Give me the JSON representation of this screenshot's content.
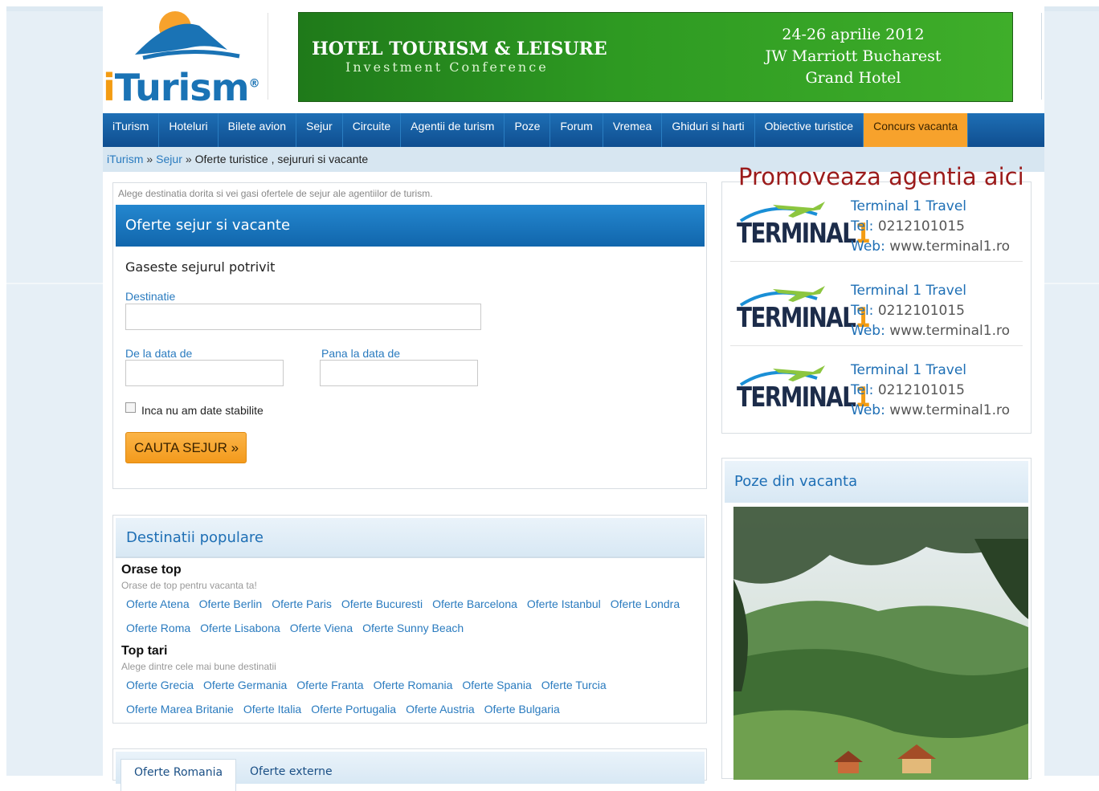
{
  "brand": {
    "logo_text_i": "i",
    "logo_text_rest": "Turism",
    "registered": "®"
  },
  "banner": {
    "title": "HOTEL TOURISM & LEISURE",
    "subtitle": "Investment Conference",
    "date": "24-26 aprilie 2012",
    "venue_line1": "JW Marriott Bucharest",
    "venue_line2": "Grand Hotel"
  },
  "nav": {
    "items": [
      {
        "label": "iTurism"
      },
      {
        "label": "Hoteluri"
      },
      {
        "label": "Bilete avion"
      },
      {
        "label": "Sejur"
      },
      {
        "label": "Circuite"
      },
      {
        "label": "Agentii de turism"
      },
      {
        "label": "Poze"
      },
      {
        "label": "Forum"
      },
      {
        "label": "Vremea"
      },
      {
        "label": "Ghiduri si harti"
      },
      {
        "label": "Obiective turistice"
      },
      {
        "label": "Concurs vacanta"
      }
    ],
    "active_color": "#f7a22c"
  },
  "breadcrumb": {
    "home": "iTurism",
    "sep": "»",
    "section": "Sejur",
    "current": "Oferte turistice , sejururi si vacante"
  },
  "search": {
    "hint": "Alege destinatia dorita si vei gasi ofertele de sejur ale agentiilor de turism.",
    "header": "Oferte sejur si vacante",
    "title": "Gaseste sejurul potrivit",
    "destination_label": "Destinatie",
    "destination_value": "",
    "from_label": "De la data de",
    "from_value": "",
    "to_label": "Pana la data de",
    "to_value": "",
    "no_dates_label": "Inca nu am date stabilite",
    "button": "CAUTA SEJUR »"
  },
  "destinations": {
    "header": "Destinatii populare",
    "cities_title": "Orase top",
    "cities_sub": "Orase de top pentru vacanta ta!",
    "cities_row1": [
      "Oferte Atena",
      "Oferte Berlin",
      "Oferte Paris",
      "Oferte Bucuresti",
      "Oferte Barcelona",
      "Oferte Istanbul",
      "Oferte Londra"
    ],
    "cities_row2": [
      "Oferte Roma",
      "Oferte Lisabona",
      "Oferte Viena",
      "Oferte Sunny Beach"
    ],
    "countries_title": "Top tari",
    "countries_sub": "Alege dintre cele mai bune destinatii",
    "countries_row1": [
      "Oferte Grecia",
      "Oferte Germania",
      "Oferte Franta",
      "Oferte Romania",
      "Oferte Spania",
      "Oferte Turcia"
    ],
    "countries_row2": [
      "Oferte Marea Britanie",
      "Oferte Italia",
      "Oferte Portugalia",
      "Oferte Austria",
      "Oferte Bulgaria"
    ]
  },
  "tabs": {
    "items": [
      "Oferte Romania",
      "Oferte externe"
    ]
  },
  "promo": {
    "title": "Promoveaza agentia aici",
    "ads": [
      {
        "logo": "TERMINAL",
        "logo_num": "1",
        "name": "Terminal 1 Travel",
        "tel_label": "Tel:",
        "tel": "0212101015",
        "web_label": "Web:",
        "web": "www.terminal1.ro"
      },
      {
        "logo": "TERMINAL",
        "logo_num": "1",
        "name": "Terminal 1 Travel",
        "tel_label": "Tel:",
        "tel": "0212101015",
        "web_label": "Web:",
        "web": "www.terminal1.ro"
      },
      {
        "logo": "TERMINAL",
        "logo_num": "1",
        "name": "Terminal 1 Travel",
        "tel_label": "Tel:",
        "tel": "0212101015",
        "web_label": "Web:",
        "web": "www.terminal1.ro"
      }
    ]
  },
  "photos": {
    "header": "Poze din vacanta"
  }
}
